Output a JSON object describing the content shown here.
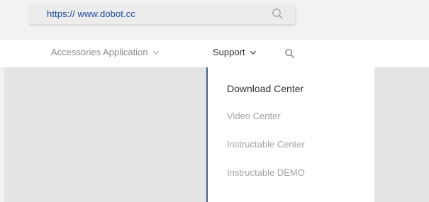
{
  "browser": {
    "url": "https://  www.dobot.cc",
    "search_icon": "search-icon"
  },
  "nav": {
    "items": [
      {
        "label": "Accessories Application",
        "icon": "chevron-down-icon"
      },
      {
        "label": "Support",
        "icon": "chevron-down-icon"
      }
    ],
    "search_icon": "search-icon"
  },
  "dropdown": {
    "items": [
      {
        "label": "Download Center",
        "state": "active"
      },
      {
        "label": "Video Center",
        "state": "default"
      },
      {
        "label": "Instructable Center",
        "state": "default"
      },
      {
        "label": "Instructable DEMO",
        "state": "default"
      }
    ]
  },
  "colors": {
    "link_blue": "#1b4a9c",
    "active_text": "#333333",
    "muted_text": "#a3a3a3",
    "divider": "#4a5f82"
  }
}
